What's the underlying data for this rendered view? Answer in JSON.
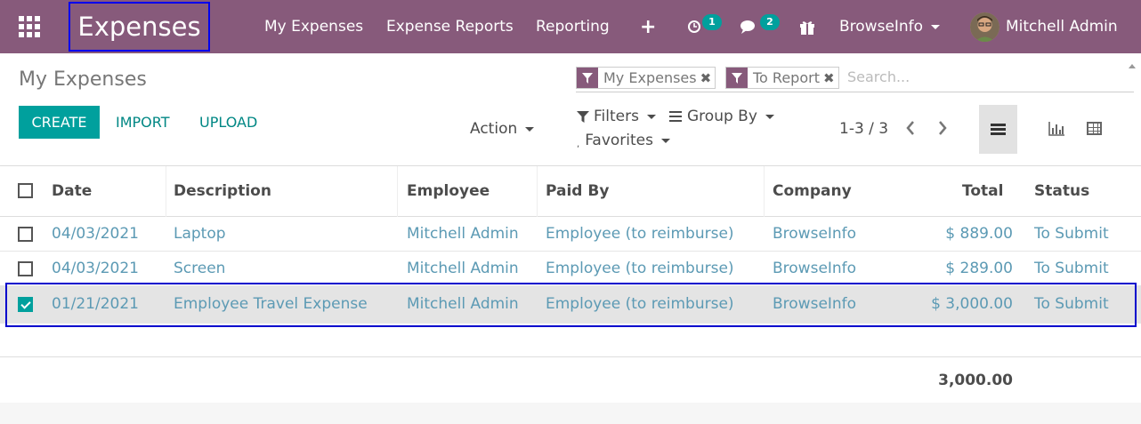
{
  "navbar": {
    "brand": "Expenses",
    "menus": [
      "My Expenses",
      "Expense Reports",
      "Reporting"
    ],
    "activity_count": "1",
    "messages_count": "2",
    "company": "BrowseInfo",
    "user": "Mitchell Admin",
    "color": "#875a7b",
    "icons": [
      "apps-grid-icon",
      "plus-icon",
      "clock-icon",
      "comments-icon",
      "gift-icon"
    ]
  },
  "control_panel": {
    "title": "My Expenses",
    "create_label": "CREATE",
    "import_label": "IMPORT",
    "upload_label": "UPLOAD",
    "action_label": "Action",
    "facets": [
      "My Expenses",
      "To Report"
    ],
    "search_placeholder": "Search...",
    "filters_label": "Filters",
    "groupby_label": "Group By",
    "favorites_label": "Favorites",
    "pager": "1-3 / 3",
    "accent": "#00a09d"
  },
  "table": {
    "headers": [
      "Date",
      "Description",
      "Employee",
      "Paid By",
      "Company",
      "Total",
      "Status"
    ],
    "rows": [
      {
        "date": "04/03/2021",
        "description": "Laptop",
        "employee": "Mitchell Admin",
        "paid_by": "Employee (to reimburse)",
        "company": "BrowseInfo",
        "total": "$ 889.00",
        "status": "To Submit",
        "selected": false
      },
      {
        "date": "04/03/2021",
        "description": "Screen",
        "employee": "Mitchell Admin",
        "paid_by": "Employee (to reimburse)",
        "company": "BrowseInfo",
        "total": "$ 289.00",
        "status": "To Submit",
        "selected": false
      },
      {
        "date": "01/21/2021",
        "description": "Employee Travel Expense",
        "employee": "Mitchell Admin",
        "paid_by": "Employee (to reimburse)",
        "company": "BrowseInfo",
        "total": "$ 3,000.00",
        "status": "To Submit",
        "selected": true
      }
    ],
    "total_sum": "3,000.00"
  }
}
